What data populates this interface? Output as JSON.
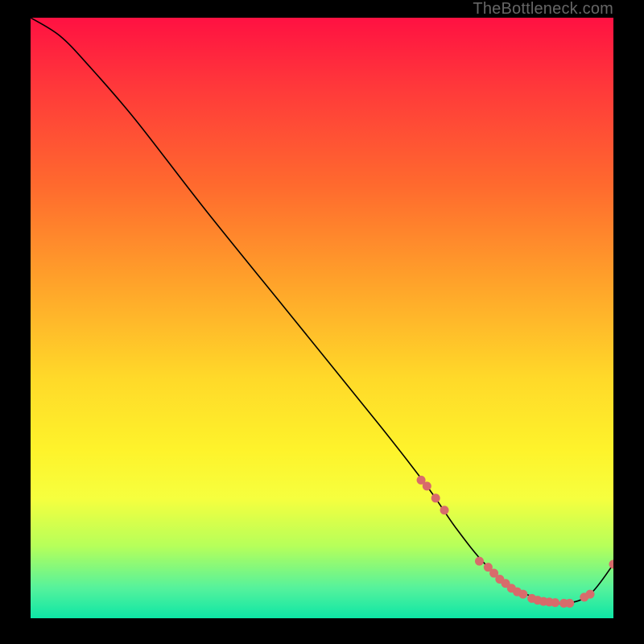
{
  "watermark": "TheBottleneck.com",
  "chart_data": {
    "type": "line",
    "title": "",
    "xlabel": "",
    "ylabel": "",
    "xlim": [
      0,
      100
    ],
    "ylim": [
      0,
      100
    ],
    "series": [
      {
        "name": "curve",
        "x": [
          0,
          5,
          10,
          18,
          30,
          45,
          60,
          68,
          73,
          78,
          83,
          88,
          92,
          96,
          100
        ],
        "y": [
          100,
          97,
          92,
          83,
          68,
          50,
          32,
          22,
          15,
          9,
          5,
          3,
          2.5,
          4,
          9
        ]
      }
    ],
    "markers": {
      "name": "highlight-points",
      "color": "#d86b6b",
      "x": [
        67,
        68,
        69.5,
        71,
        77,
        78.5,
        79.5,
        80.5,
        81.5,
        82.5,
        83.5,
        84.5,
        86,
        87,
        88,
        89,
        90,
        91.5,
        92.5,
        95,
        96,
        100
      ],
      "y": [
        23,
        22,
        20,
        18,
        9.5,
        8.5,
        7.5,
        6.5,
        5.8,
        5,
        4.4,
        4,
        3.3,
        3,
        2.8,
        2.7,
        2.6,
        2.5,
        2.5,
        3.5,
        4,
        9
      ]
    },
    "gradient_stops": [
      {
        "pos": 0,
        "color": "#ff1142"
      },
      {
        "pos": 12,
        "color": "#ff3a3a"
      },
      {
        "pos": 28,
        "color": "#ff6a2e"
      },
      {
        "pos": 44,
        "color": "#ffa22a"
      },
      {
        "pos": 60,
        "color": "#ffd929"
      },
      {
        "pos": 72,
        "color": "#fef32b"
      },
      {
        "pos": 80,
        "color": "#f6ff3e"
      },
      {
        "pos": 88,
        "color": "#b6ff5a"
      },
      {
        "pos": 95,
        "color": "#55f29c"
      },
      {
        "pos": 100,
        "color": "#0de6a6"
      }
    ]
  }
}
